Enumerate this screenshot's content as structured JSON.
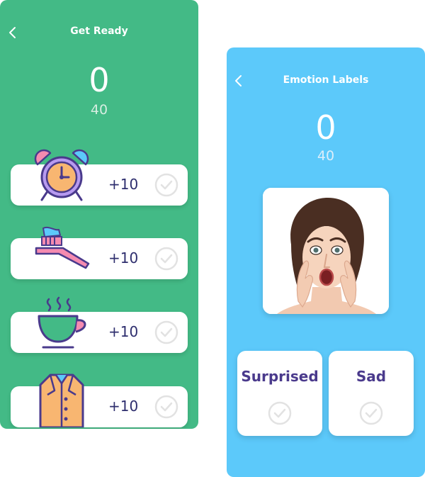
{
  "left": {
    "title": "Get Ready",
    "score": "0",
    "total": "40",
    "tasks": [
      {
        "icon": "alarm-clock-icon",
        "points": "+10"
      },
      {
        "icon": "toothbrush-icon",
        "points": "+10"
      },
      {
        "icon": "coffee-cup-icon",
        "points": "+10"
      },
      {
        "icon": "coat-icon",
        "points": "+10"
      }
    ]
  },
  "right": {
    "title": "Emotion Labels",
    "score": "0",
    "total": "40",
    "photo_icon": "surprised-face-photo",
    "answers": [
      {
        "label": "Surprised"
      },
      {
        "label": "Sad"
      }
    ]
  },
  "colors": {
    "green_bg": "#43BA86",
    "blue_bg": "#5CC9FA",
    "text_dark": "#2E2E6E",
    "answer_text": "#4A3A8C",
    "check_gray": "#e2e2e2"
  }
}
